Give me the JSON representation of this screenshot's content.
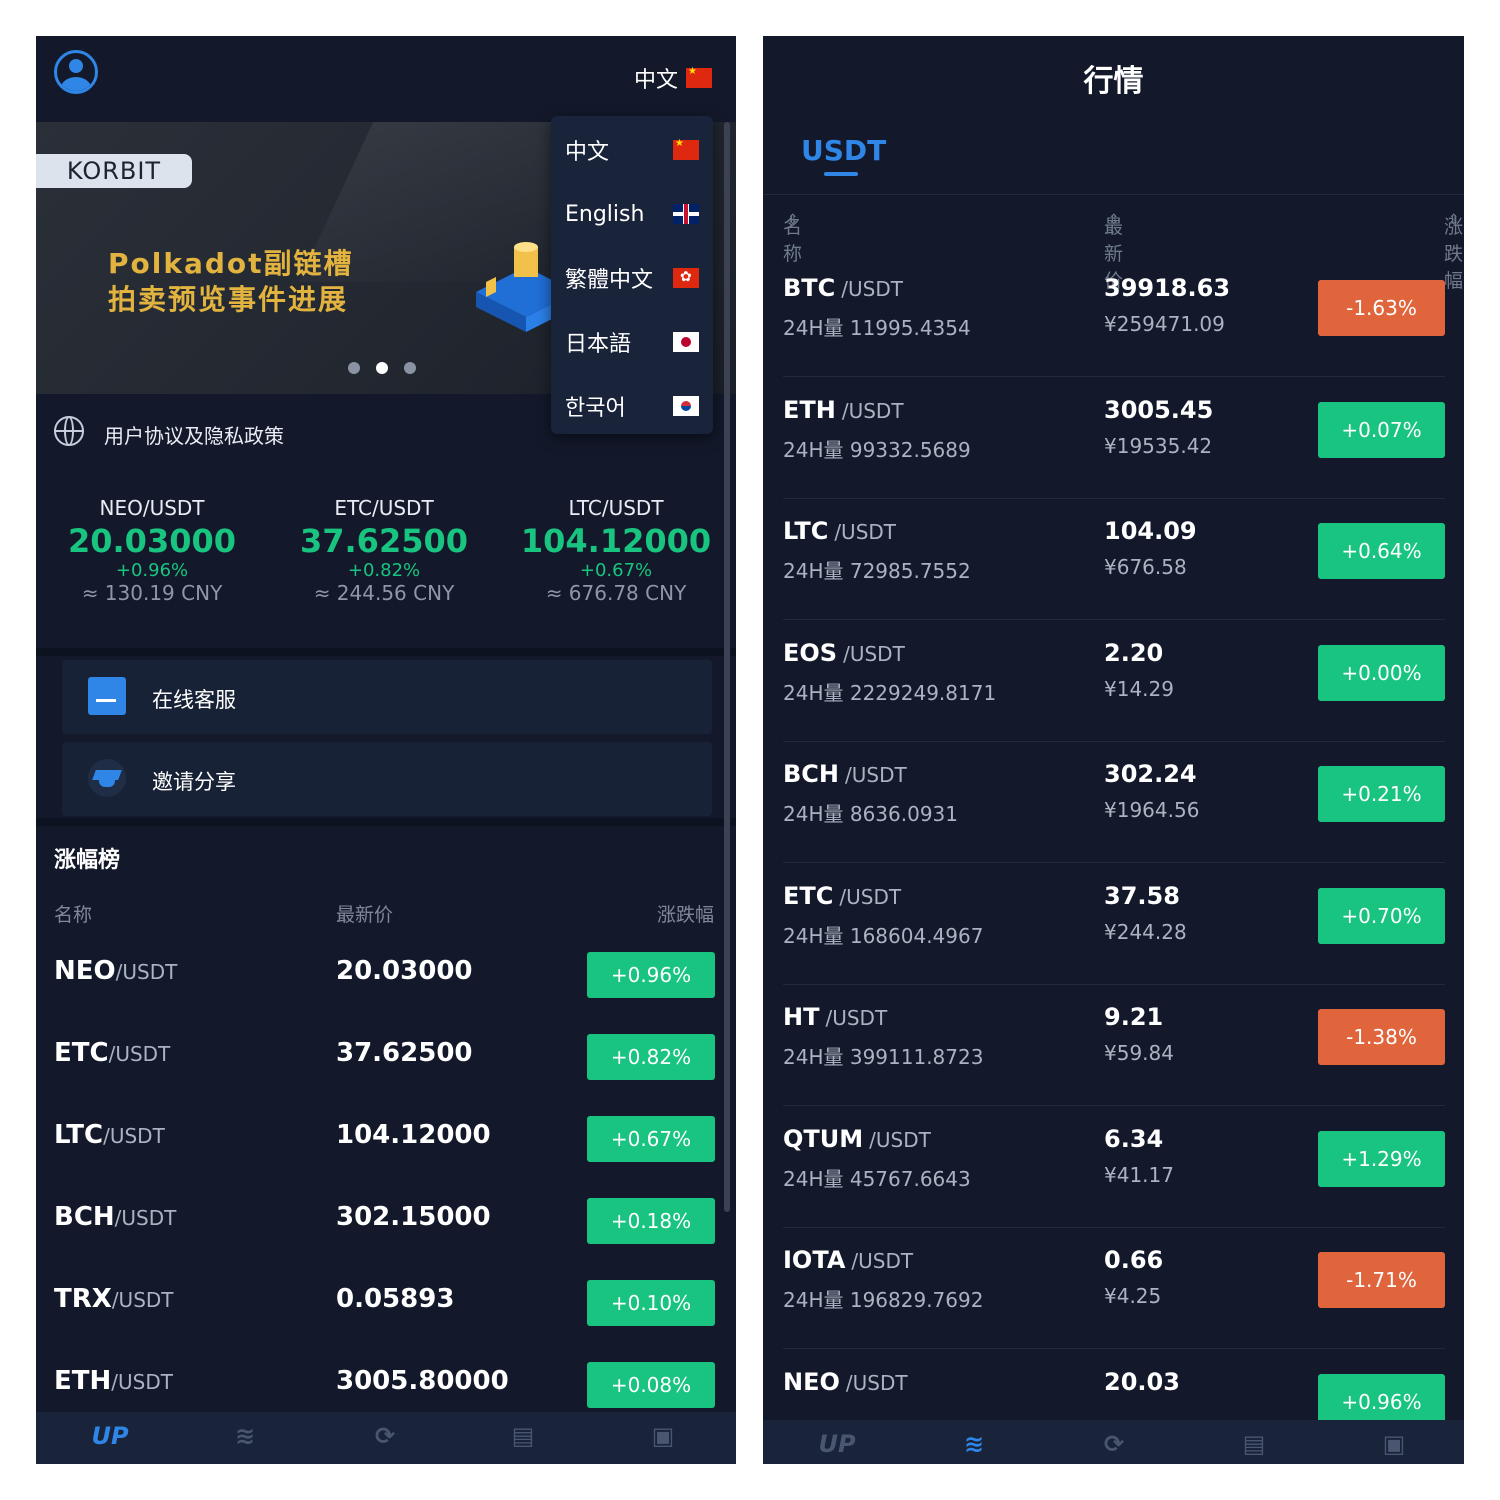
{
  "left": {
    "lang_current": "中文",
    "banner": {
      "tag": "KORBIT",
      "line1": "Polkadot副链槽",
      "line2": "拍卖预览事件进展"
    },
    "languages": [
      {
        "label": "中文",
        "flag": "cn-flag-icon"
      },
      {
        "label": "English",
        "flag": "uk-flag-icon"
      },
      {
        "label": "繁體中文",
        "flag": "hk-flag-icon"
      },
      {
        "label": "日本語",
        "flag": "jp-flag-icon"
      },
      {
        "label": "한국어",
        "flag": "kr-flag-icon"
      }
    ],
    "notice": "用户协议及隐私政策",
    "tickers": [
      {
        "pair": "NEO/USDT",
        "price": "20.03000",
        "change": "+0.96%",
        "cny": "≈ 130.19 CNY"
      },
      {
        "pair": "ETC/USDT",
        "price": "37.62500",
        "change": "+0.82%",
        "cny": "≈ 244.56 CNY"
      },
      {
        "pair": "LTC/USDT",
        "price": "104.12000",
        "change": "+0.67%",
        "cny": "≈ 676.78 CNY"
      }
    ],
    "menu": [
      {
        "label": "在线客服",
        "icon": "document-icon"
      },
      {
        "label": "邀请分享",
        "icon": "graduation-cap-icon"
      }
    ],
    "gainers": {
      "title": "涨幅榜",
      "headers": {
        "name": "名称",
        "price": "最新价",
        "change": "涨跌幅"
      },
      "rows": [
        {
          "coin": "NEO",
          "quote": "/USDT",
          "price": "20.03000",
          "change": "+0.96%"
        },
        {
          "coin": "ETC",
          "quote": "/USDT",
          "price": "37.62500",
          "change": "+0.82%"
        },
        {
          "coin": "LTC",
          "quote": "/USDT",
          "price": "104.12000",
          "change": "+0.67%"
        },
        {
          "coin": "BCH",
          "quote": "/USDT",
          "price": "302.15000",
          "change": "+0.18%"
        },
        {
          "coin": "TRX",
          "quote": "/USDT",
          "price": "0.05893",
          "change": "+0.10%"
        },
        {
          "coin": "ETH",
          "quote": "/USDT",
          "price": "3005.80000",
          "change": "+0.08%"
        }
      ]
    },
    "tabbar": {
      "home_label": "UP",
      "icons": [
        "market-icon",
        "exchange-icon",
        "orders-icon",
        "wallet-icon"
      ]
    }
  },
  "right": {
    "title": "行情",
    "tab": "USDT",
    "headers": {
      "name": "名称",
      "price": "最新价",
      "change": "涨跌幅"
    },
    "rows": [
      {
        "coin": "BTC",
        "quote": "/USDT",
        "volume": "24H量 11995.4354",
        "price": "39918.63",
        "cny": "¥259471.09",
        "change": "-1.63%",
        "dir": "down"
      },
      {
        "coin": "ETH",
        "quote": "/USDT",
        "volume": "24H量 99332.5689",
        "price": "3005.45",
        "cny": "¥19535.42",
        "change": "+0.07%",
        "dir": "up"
      },
      {
        "coin": "LTC",
        "quote": "/USDT",
        "volume": "24H量 72985.7552",
        "price": "104.09",
        "cny": "¥676.58",
        "change": "+0.64%",
        "dir": "up"
      },
      {
        "coin": "EOS",
        "quote": "/USDT",
        "volume": "24H量 2229249.8171",
        "price": "2.20",
        "cny": "¥14.29",
        "change": "+0.00%",
        "dir": "up"
      },
      {
        "coin": "BCH",
        "quote": "/USDT",
        "volume": "24H量 8636.0931",
        "price": "302.24",
        "cny": "¥1964.56",
        "change": "+0.21%",
        "dir": "up"
      },
      {
        "coin": "ETC",
        "quote": "/USDT",
        "volume": "24H量 168604.4967",
        "price": "37.58",
        "cny": "¥244.28",
        "change": "+0.70%",
        "dir": "up"
      },
      {
        "coin": "HT",
        "quote": "/USDT",
        "volume": "24H量 399111.8723",
        "price": "9.21",
        "cny": "¥59.84",
        "change": "-1.38%",
        "dir": "down"
      },
      {
        "coin": "QTUM",
        "quote": "/USDT",
        "volume": "24H量 45767.6643",
        "price": "6.34",
        "cny": "¥41.17",
        "change": "+1.29%",
        "dir": "up"
      },
      {
        "coin": "IOTA",
        "quote": "/USDT",
        "volume": "24H量 196829.7692",
        "price": "0.66",
        "cny": "¥4.25",
        "change": "-1.71%",
        "dir": "down"
      },
      {
        "coin": "NEO",
        "quote": "/USDT",
        "volume": "",
        "price": "20.03",
        "cny": "",
        "change": "+0.96%",
        "dir": "up"
      }
    ],
    "tabbar": {
      "home_label": "UP",
      "icons": [
        "market-icon",
        "exchange-icon",
        "orders-icon",
        "wallet-icon"
      ]
    }
  },
  "colors": {
    "background": "#13192a",
    "accent": "#2f86e6",
    "up": "#18c47f",
    "down": "#e0653c",
    "banner_gold": "#e2b43f"
  }
}
